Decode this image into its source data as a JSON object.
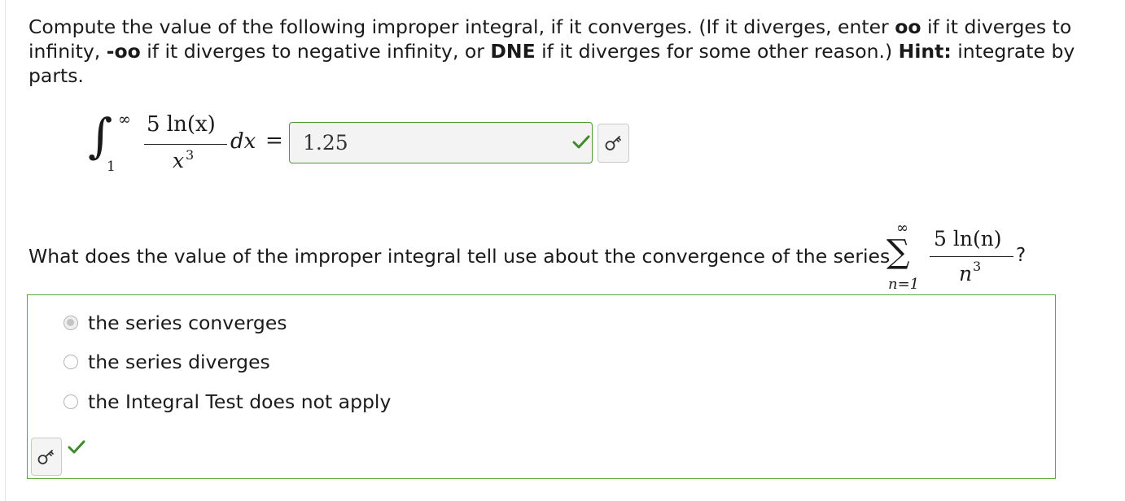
{
  "problem": {
    "t1": "Compute the value of the following improper integral, if it converges. (If it diverges, enter ",
    "b1": "oo",
    "t2": " if it diverges to infinity, ",
    "b2": "-oo",
    "t3": " if it diverges to negative infinity, or ",
    "b3": "DNE",
    "t4": " if it diverges for some other reason.) ",
    "b4": "Hint:",
    "t5": " integrate by parts."
  },
  "integral": {
    "upper": "∞",
    "lower": "1",
    "numerator": "5 ln(x)",
    "denominator": "x",
    "exponent": "3",
    "differential": "dx",
    "equals": "="
  },
  "answer": {
    "value": "1.25",
    "status": "correct"
  },
  "question2": {
    "text": "What does the value of the improper integral tell use about the convergence of the series"
  },
  "series": {
    "upper": "∞",
    "sigma": "∑",
    "lower": "n=1",
    "numerator": "5 ln(n)",
    "denominator": "n",
    "exponent": "3",
    "question_mark": "?"
  },
  "choices": {
    "options": [
      {
        "label": "the series converges",
        "selected": true
      },
      {
        "label": "the series diverges",
        "selected": false
      },
      {
        "label": "the Integral Test does not apply",
        "selected": false
      }
    ],
    "status": "correct"
  },
  "colors": {
    "correct": "#3d8b2a",
    "border": "#5aa83a"
  },
  "icons": {
    "check": "check-icon",
    "key": "key-icon"
  }
}
